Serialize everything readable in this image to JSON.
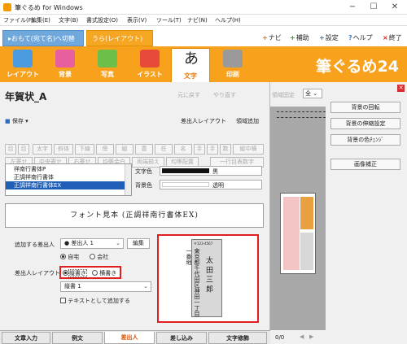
{
  "window": {
    "title": "筆ぐるめ for Windows",
    "min": "−",
    "max": "☐",
    "close": "✕"
  },
  "menu": [
    "ファイル(F)",
    "編集(E)",
    "文字(B)",
    "書式設定(O)",
    "表示(V)",
    "ツール(T)",
    "ナビ(N)",
    "ヘルプ(H)"
  ],
  "mode_tabs": {
    "omote": "▸おもて(宛て名)へ切替",
    "ura": "うら(レイアウト)"
  },
  "top_links": [
    {
      "icon": "+",
      "label": "ナビ"
    },
    {
      "icon": "+",
      "label": "補助"
    },
    {
      "icon": "+",
      "label": "設定"
    },
    {
      "icon": "?",
      "label": "ヘルプ"
    },
    {
      "icon": "×",
      "label": "終了"
    }
  ],
  "toolbar": [
    "レイアウト",
    "背景",
    "写真",
    "イラスト",
    "文字",
    "印刷"
  ],
  "brand": "筆ぐるめ24",
  "panel": {
    "title": "年賀状_A",
    "undo": "元に戻す",
    "redo": "やり直す",
    "save": "保存",
    "sender_layout": "差出人レイアウト",
    "add_area": "領域追加"
  },
  "format_row1": [
    "目",
    "目",
    "太字",
    "斜体",
    "下線",
    "傍",
    "縦",
    "豊",
    "任",
    "名",
    "手",
    "手",
    "数",
    "縦中横"
  ],
  "format_row2": [
    "左寄せ",
    "中央寄せ",
    "右寄せ",
    "均等余白",
    "両端揃え",
    "均等配置",
    "一行目表数字"
  ],
  "fonts": [
    "祥南行書体P",
    "正調祥南行書体",
    "正調祥南行書体EX"
  ],
  "text_color": {
    "label": "文字色",
    "value": "黒"
  },
  "bg_color": {
    "label": "背景色",
    "value": "透明"
  },
  "font_preview": "フォント見本 (正調祥南行書体EX)",
  "sender": {
    "label": "追加する差出人",
    "value": "● 差出人 1",
    "edit": "編集",
    "home": "自宅",
    "company": "会社",
    "layout_label": "差出人レイアウト",
    "tategaki": "縦書き",
    "yokogaki": "横書き",
    "layout_select": "縦書 1",
    "text_checkbox": "テキストとして追加する"
  },
  "address_card": {
    "postal": "〒123-4567",
    "address": "東京都千代田区神田一丁目一番地",
    "name": "太 田 三 郎"
  },
  "bottom_tabs": [
    "文章入力",
    "例文",
    "差出人",
    "差し込み",
    "文字修飾"
  ],
  "active_tab": "差出人",
  "mid": {
    "zoom_label": "領域固定",
    "zoom_value": "全",
    "page": "0/0"
  },
  "right_buttons": [
    "背景の回転",
    "背景の伸縮設定",
    "背景の色ﾁｪﾝｼﾞ",
    "画像補正"
  ]
}
